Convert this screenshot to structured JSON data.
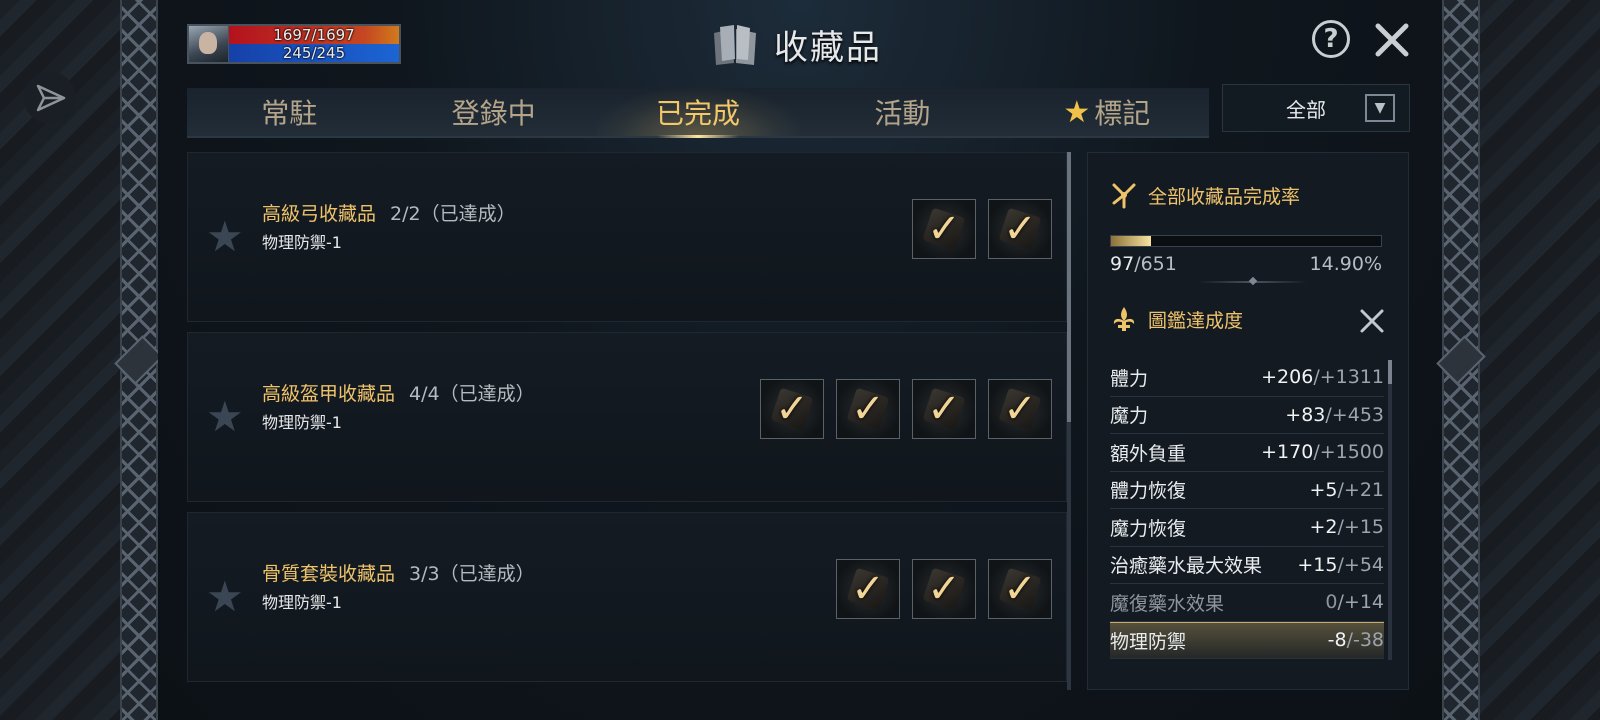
{
  "player": {
    "hp": "1697/1697",
    "mp": "245/245"
  },
  "header": {
    "title": "收藏品"
  },
  "tabs": [
    {
      "label": "常駐"
    },
    {
      "label": "登錄中"
    },
    {
      "label": "已完成"
    },
    {
      "label": "活動"
    },
    {
      "label": "標記"
    }
  ],
  "active_tab": "已完成",
  "filter": {
    "selected": "全部"
  },
  "collections": [
    {
      "title": "高級弓收藏品",
      "progress": "2/2（已達成）",
      "effect": "物理防禦-1",
      "item_count": 2
    },
    {
      "title": "高級盔甲收藏品",
      "progress": "4/4（已達成）",
      "effect": "物理防禦-1",
      "item_count": 4
    },
    {
      "title": "骨質套裝收藏品",
      "progress": "3/3（已達成）",
      "effect": "物理防禦-1",
      "item_count": 3
    }
  ],
  "summary": {
    "completion_title": "全部收藏品完成率",
    "count_current": "97",
    "count_total": "/651",
    "percent": "14.90%",
    "fill_fraction": 0.149,
    "codex_title": "圖鑑達成度"
  },
  "stats": [
    {
      "name": "體力",
      "cur": "+206",
      "max": "/+1311"
    },
    {
      "name": "魔力",
      "cur": "+83",
      "max": "/+453"
    },
    {
      "name": "額外負重",
      "cur": "+170",
      "max": "/+1500"
    },
    {
      "name": "體力恢復",
      "cur": "+5",
      "max": "/+21"
    },
    {
      "name": "魔力恢復",
      "cur": "+2",
      "max": "/+15"
    },
    {
      "name": "治癒藥水最大效果",
      "cur": "+15",
      "max": "/+54"
    },
    {
      "name": "魔復藥水效果",
      "cur": "0",
      "max": "/+14"
    },
    {
      "name": "物理防禦",
      "cur": "-8",
      "max": "/-38"
    }
  ],
  "colors": {
    "accent_gold": "#efc36a",
    "hp_red": "#b3121e",
    "mp_blue": "#1c64d4"
  }
}
